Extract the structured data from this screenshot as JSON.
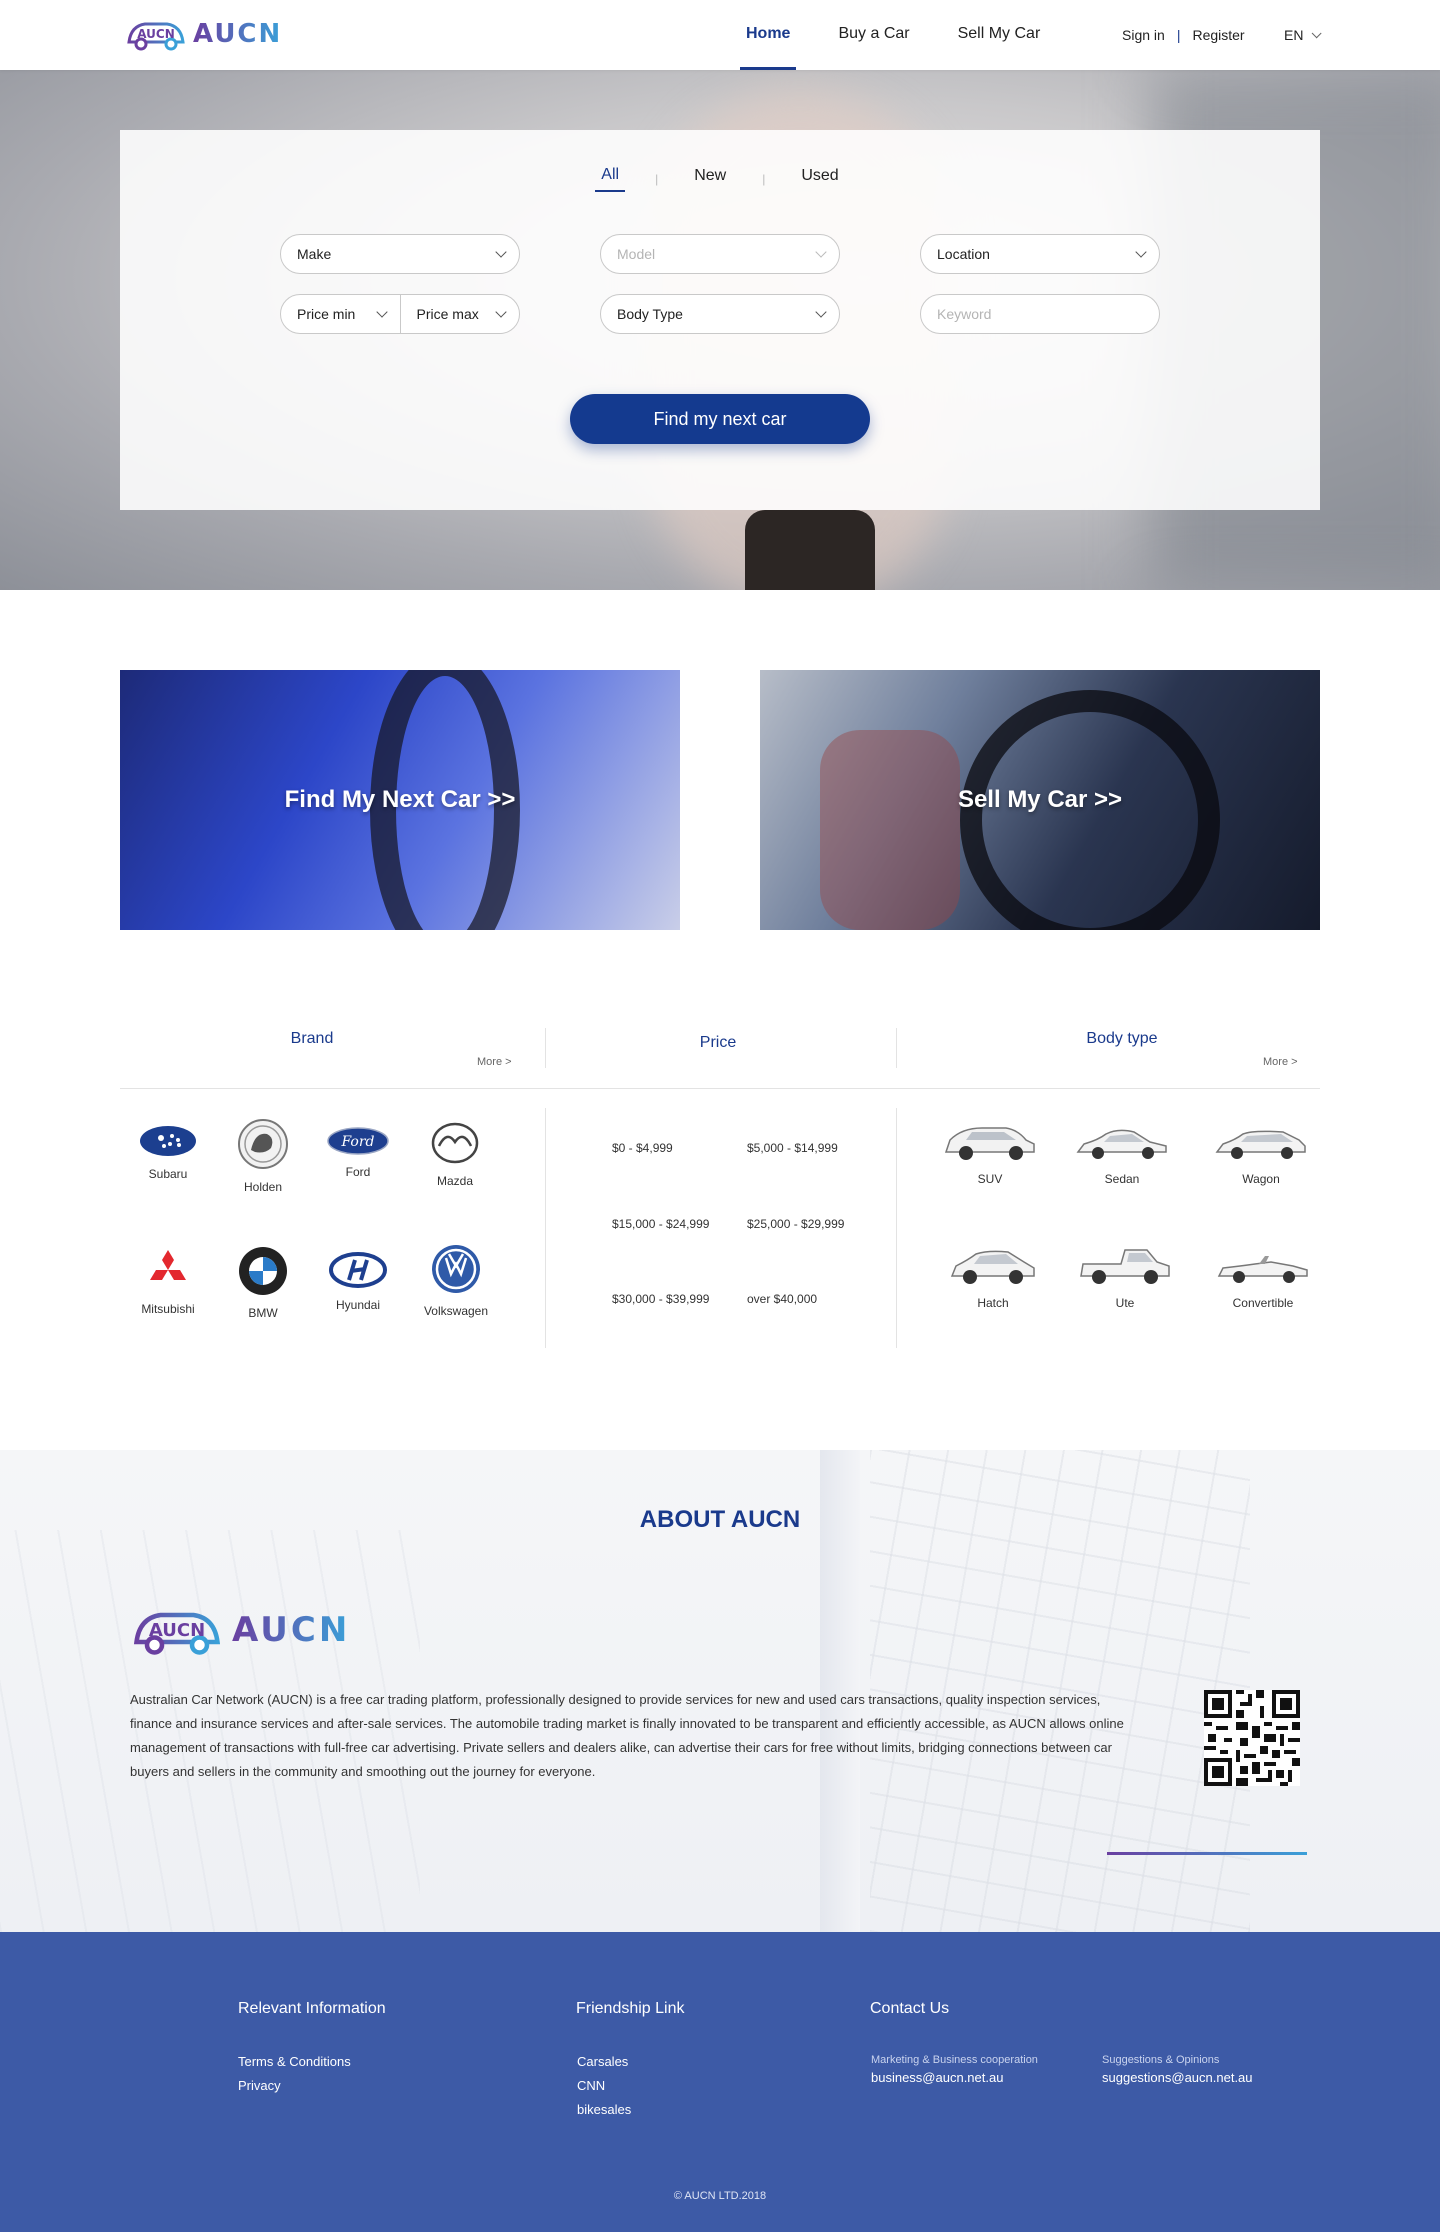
{
  "header": {
    "logo_text": "AUCN",
    "nav": [
      "Home",
      "Buy a Car",
      "Sell My Car"
    ],
    "sign_in": "Sign in",
    "separator": "|",
    "register": "Register",
    "language": "EN"
  },
  "search": {
    "tabs": [
      "All",
      "New",
      "Used"
    ],
    "make": "Make",
    "model_placeholder": "Model",
    "location": "Location",
    "price_min": "Price min",
    "price_max": "Price max",
    "body_type": "Body Type",
    "keyword_placeholder": "Keyword",
    "submit": "Find my next car"
  },
  "promos": {
    "find": "Find My Next Car >>",
    "sell": "Sell My Car >>"
  },
  "categories": {
    "brand_title": "Brand",
    "price_title": "Price",
    "body_title": "Body type",
    "more": "More >",
    "brands": [
      "Subaru",
      "Holden",
      "Ford",
      "Mazda",
      "Mitsubishi",
      "BMW",
      "Hyundai",
      "Volkswagen"
    ],
    "prices": [
      "$0 - $4,999",
      "$5,000 - $14,999",
      "$15,000 - $24,999",
      "$25,000 - $29,999",
      "$30,000 - $39,999",
      "over $40,000"
    ],
    "body_types": [
      "SUV",
      "Sedan",
      "Wagon",
      "Hatch",
      "Ute",
      "Convertible"
    ]
  },
  "about": {
    "title": "ABOUT AUCN",
    "logo_text": "AUCN",
    "text": "Australian Car Network (AUCN) is a free car trading platform, professionally designed to provide services for new and used cars transactions, quality inspection services, finance and insurance services and after-sale services. The automobile trading market is finally innovated to be transparent and efficiently accessible, as AUCN allows online management of transactions with full-free car advertising. Private sellers and dealers alike, can advertise their cars for free without limits, bridging connections between car buyers and sellers in the community and smoothing out the journey for everyone."
  },
  "footer": {
    "relevant_title": "Relevant Information",
    "relevant_links": [
      "Terms & Conditions",
      "Privacy"
    ],
    "friend_title": "Friendship Link",
    "friend_links": [
      "Carsales",
      "CNN",
      "bikesales"
    ],
    "contact_title": "Contact Us",
    "business_label": "Marketing & Business cooperation",
    "business_email": "business@aucn.net.au",
    "suggest_label": "Suggestions & Opinions",
    "suggest_email": "suggestions@aucn.net.au",
    "copyright": "© AUCN LTD.2018"
  },
  "colors": {
    "primary": "#1a3a8c",
    "button": "#143a8f",
    "footer": "#3d5aa6",
    "logo_gradient_start": "#6a3fa0",
    "logo_gradient_end": "#3aa0d8"
  }
}
